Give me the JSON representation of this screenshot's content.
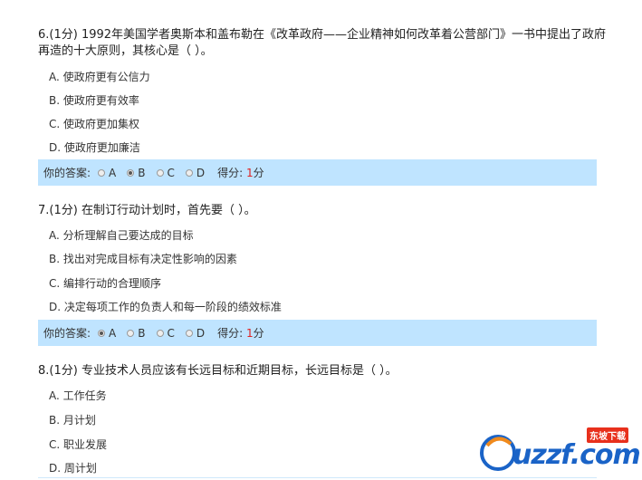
{
  "questions": [
    {
      "title_line1": "6.(1分) 1992年美国学者奥斯本和盖布勒在《改革政府——企业精神如何改革着公营部门》一书中提出了政府",
      "title_line2": "再造的十大原则，其核心是（  ）。",
      "options": [
        "A. 使政府更有公信力",
        "B. 使政府更有效率",
        "C. 使政府更加集权",
        "D. 使政府更加廉洁"
      ],
      "answer_label": "你的答案:",
      "choices": [
        "A",
        "B",
        "C",
        "D"
      ],
      "selected": "B",
      "score_label": "得分:",
      "score_value": "1",
      "score_unit": "分"
    },
    {
      "title_line1": "7.(1分) 在制订行动计划时，首先要（  ）。",
      "options": [
        "A. 分析理解自己要达成的目标",
        "B. 找出对完成目标有决定性影响的因素",
        "C. 编排行动的合理顺序",
        "D. 决定每项工作的负责人和每一阶段的绩效标准"
      ],
      "answer_label": "你的答案:",
      "choices": [
        "A",
        "B",
        "C",
        "D"
      ],
      "selected": "A",
      "score_label": "得分:",
      "score_value": "1",
      "score_unit": "分"
    },
    {
      "title_line1": "8.(1分) 专业技术人员应该有长远目标和近期目标，长远目标是（  ）。",
      "options": [
        "A. 工作任务",
        "B. 月计划",
        "C. 职业发展",
        "D. 周计划"
      ]
    }
  ],
  "watermark": {
    "text": "uzzf.com",
    "badge": "东坡下载"
  },
  "colors": {
    "answer_bar": "#bfe4ff",
    "score_red": "#e02020"
  }
}
